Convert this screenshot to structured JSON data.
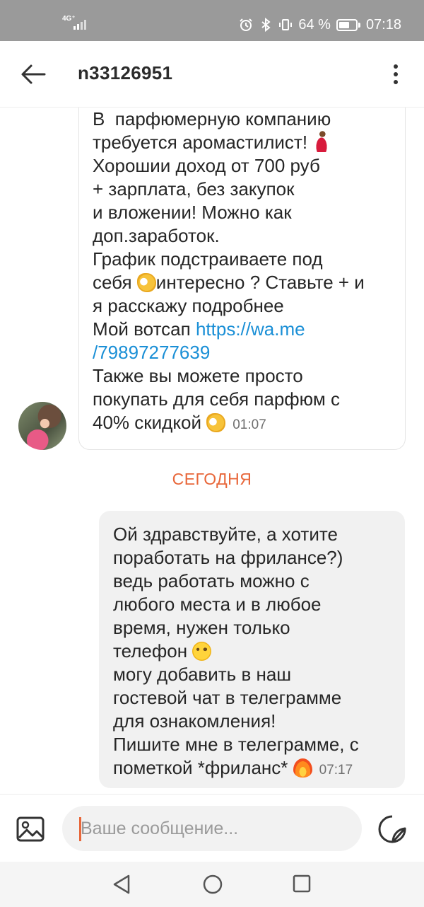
{
  "status_bar": {
    "network": "4G⁺",
    "battery_percent": "64 %",
    "battery_level": 0.64,
    "time": "07:18"
  },
  "header": {
    "title": "n33126951",
    "back_icon": "arrow-left-icon",
    "menu_icon": "more-vertical-icon"
  },
  "messages": {
    "incoming": {
      "lines_before_link": "В  парфюмерную компанию\nтребуется аромастилист! ",
      "line2": "\nХорошии доход от 700 руб\n+ зарплата, без закупок\nи вложении! Можно как\nдоп.заработок.\nГрафик подстраиваете под\nсебя ",
      "line3": "интересно ? Ставьте + и\nя расскажу подробнее\nМой вотсап ",
      "link": "https://wa.me\n/79897277639",
      "line4": "\nТакже вы можете просто\nпокупать для себя парфюм с\n40% скидкой ",
      "time": "01:07"
    },
    "date_separator": "СЕГОДНЯ",
    "outgoing": {
      "part1": "Ой здравствуйте, а хотите\nпоработать на фрилансе?)\nведь работать можно с\nлюбого места и в любое\nвремя, нужен только\nтелефон ",
      "part2": "\nмогу добавить в наш\nгостевой чат в телеграмме\nдля ознакомления!\nПишите мне в телеграмме, с\nпометкой *фриланс* ",
      "time": "07:17"
    }
  },
  "composer": {
    "placeholder": "Ваше сообщение...",
    "attach_icon": "image-icon",
    "sticker_icon": "sticker-icon"
  },
  "nav": {
    "back_icon": "triangle-back-icon",
    "home_icon": "circle-home-icon",
    "recent_icon": "square-recent-icon"
  },
  "colors": {
    "accent": "#e8673a",
    "link": "#1a8fd6",
    "outgoing_bubble": "#f1f1f1"
  }
}
